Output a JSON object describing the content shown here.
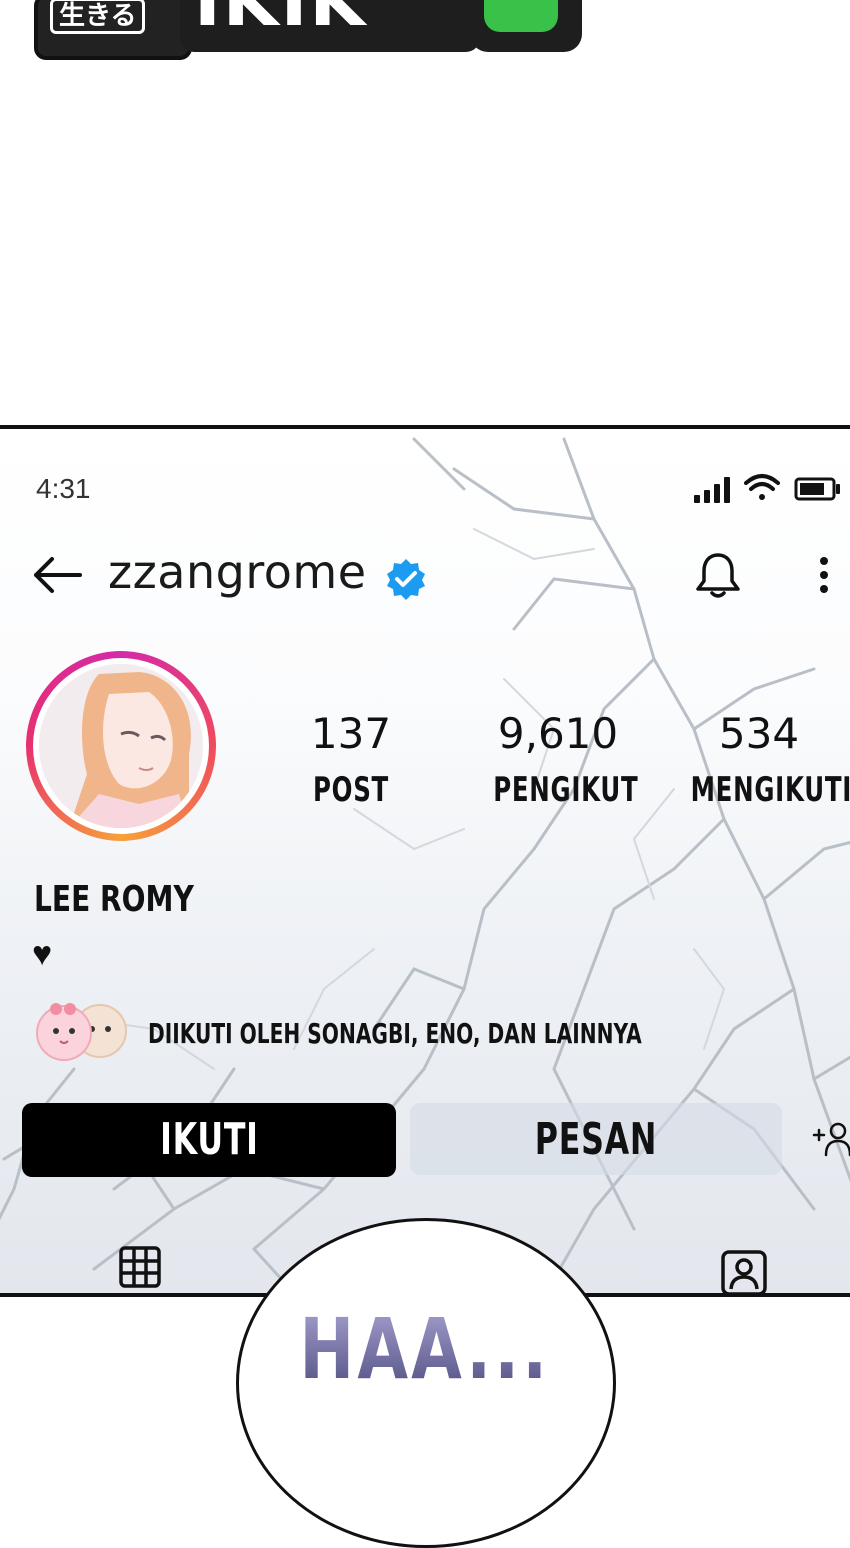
{
  "logo": {
    "jp_text": "生きる",
    "main_text": "IKIK"
  },
  "status_bar": {
    "time": "4:31"
  },
  "profile": {
    "username": "zzangrome",
    "verified": true,
    "stats": [
      {
        "value": "137",
        "label": "POST"
      },
      {
        "value": "9,610",
        "label": "PENGIKUT"
      },
      {
        "value": "534",
        "label": "MENGIKUTI"
      }
    ],
    "name": "LEE ROMY",
    "bio": "♥",
    "followed_by": "DIIKUTI OLEH SONAGBI, ENO, DAN LAINNYA"
  },
  "actions": {
    "follow_label": "IKUTI",
    "message_label": "PESAN"
  },
  "bubble": {
    "text": "HAA..."
  },
  "colors": {
    "verified_blue": "#1d9bf0",
    "follow_button": "#000000",
    "message_button": "#d6dce6",
    "bubble_text": "#6c6a9e"
  }
}
